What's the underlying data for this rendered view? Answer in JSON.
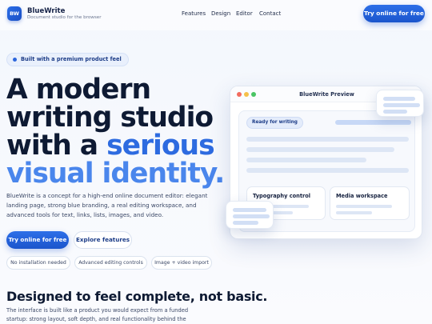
{
  "header": {
    "logo_text": "BW",
    "brand_name": "BlueWrite",
    "brand_tagline": "Document studio for the browser",
    "nav": [
      "Features",
      "Design",
      "Editor",
      "Contact"
    ],
    "cta": "Try online for free"
  },
  "hero": {
    "badge": "Built with a premium product feel",
    "line1": "A modern",
    "line2": "writing studio",
    "line3_a": "with a ",
    "line3_b": "serious",
    "line4": "visual identity.",
    "description": "BlueWrite is a concept for a high-end online document editor: elegant landing page, strong blue branding, a real editing workspace, and advanced tools for text, links, lists, images, and video.",
    "primary_button": "Try online for free",
    "secondary_button": "Explore features",
    "chips": [
      "No installation needed",
      "Advanced editing controls",
      "Image + video import"
    ]
  },
  "preview": {
    "window_title": "BlueWrite Preview",
    "status": "Ready for writing",
    "card1_title": "Typography control",
    "card2_title": "Media workspace"
  },
  "section": {
    "title": "Designed to feel complete, not basic.",
    "description": "The interface is built like a product you would expect from a funded startup: strong layout, soft depth, and real functionality behind the"
  },
  "colors": {
    "brand_blue": "#1f5fd8",
    "accent_blue": "#2d6be0",
    "accent_light": "#4a86ec",
    "dark_text": "#0e1a33"
  }
}
